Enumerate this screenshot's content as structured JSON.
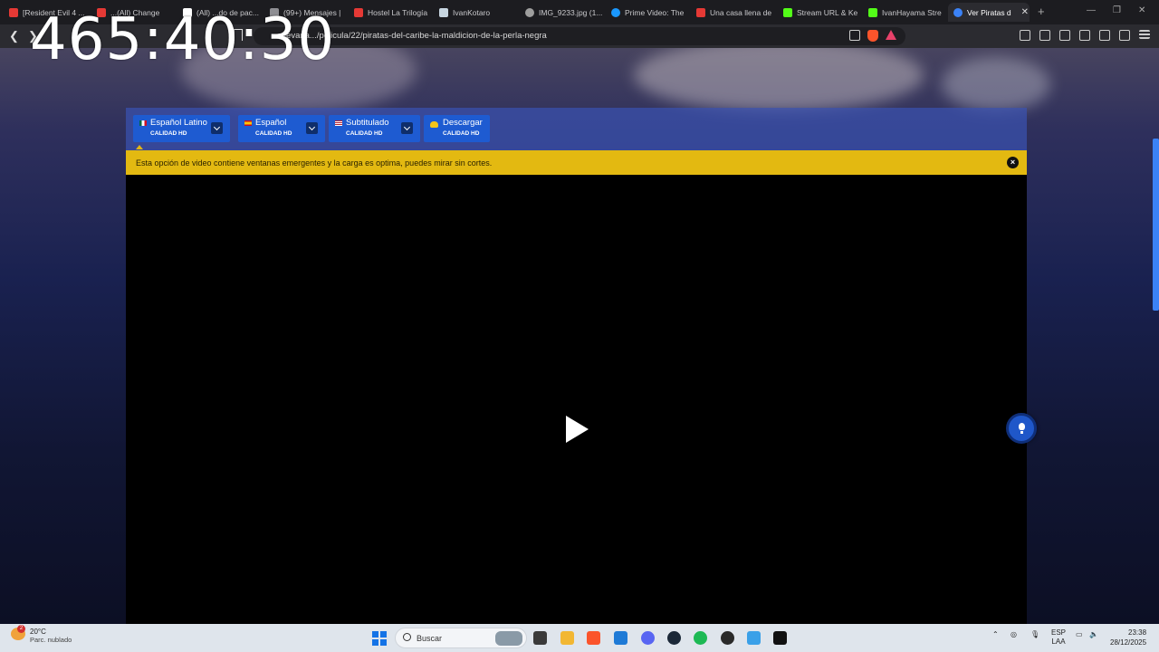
{
  "overlay": {
    "timer": "465:40:30"
  },
  "browser": {
    "tabs": [
      {
        "label": "[Resident Evil 4 ...",
        "color": "#e53935"
      },
      {
        "label": "...(All) Change",
        "color": "#e53935"
      },
      {
        "label": "(All) ...do de pac...",
        "color": "#ffffff"
      },
      {
        "label": "(99+) Mensajes |",
        "color": "#8e8e93"
      },
      {
        "label": "Hostel La Trilogía",
        "color": "#e53935"
      },
      {
        "label": "IvanKotaro",
        "color": "#c7d5e0"
      },
      {
        "label": "IMG_9233.jpg (1...",
        "color": "#9e9e9e"
      },
      {
        "label": "Prime Video: The",
        "color": "#1a98ff"
      },
      {
        "label": "Una casa llena de",
        "color": "#e53935"
      },
      {
        "label": "Stream URL & Ke",
        "color": "#53fc18"
      },
      {
        "label": "IvanHayama Stre",
        "color": "#53fc18"
      },
      {
        "label": "Ver Piratas d",
        "color": "#3b82f6"
      }
    ],
    "url": "cuevana.../pelicula/22/piratas-del-caribe-la-maldicion-de-la-perla-negra"
  },
  "player": {
    "options": [
      {
        "label": "Español Latino",
        "quality": "CALIDAD HD"
      },
      {
        "label": "Español",
        "quality": "CALIDAD HD"
      },
      {
        "label": "Subtitulado",
        "quality": "CALIDAD HD"
      },
      {
        "label": "Descargar",
        "quality": "CALIDAD HD"
      }
    ],
    "notice": "Esta opción de video contiene ventanas emergentes y la carga es optima, puedes mirar sin cortes.",
    "accent": "#1e5bd1",
    "notice_color": "#e3b911"
  },
  "taskbar": {
    "weather": {
      "temp": "20°C",
      "desc": "Parc. nublado",
      "badge": "2"
    },
    "search_placeholder": "Buscar",
    "lang": "ESP",
    "layout": "LAA",
    "time": "23:38",
    "date": "28/12/2025"
  }
}
